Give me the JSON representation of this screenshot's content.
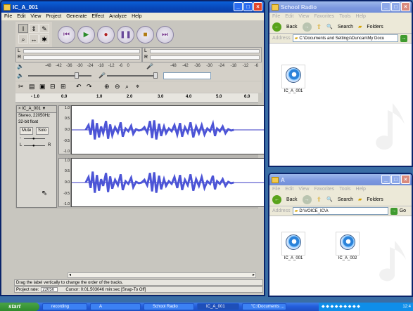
{
  "audacity": {
    "title": "IC_A_001",
    "menu": [
      "File",
      "Edit",
      "View",
      "Project",
      "Generate",
      "Effect",
      "Analyze",
      "Help"
    ],
    "meters": {
      "left": "L",
      "right": "R",
      "scale": [
        "-48",
        "-42",
        "-36",
        "-30",
        "-24",
        "-18",
        "-12",
        "-6",
        "0"
      ],
      "scale2": [
        "-48",
        "-42",
        "-36",
        "-30",
        "-24",
        "-18",
        "-12",
        "-6"
      ]
    },
    "ruler": [
      "- 1.0",
      "0.0",
      "1.0",
      "2.0",
      "3.0",
      "4.0",
      "5.0",
      "6.0"
    ],
    "track": {
      "name": "IC_A_001",
      "format": "Stereo, 22050Hz",
      "bits": "32-bit float",
      "mute": "Mute",
      "solo": "Solo",
      "l": "L",
      "r": "R",
      "scale_top": [
        "1.0",
        "0.5",
        "0.0",
        "-0.5",
        "-1.0"
      ],
      "scale_bottom": [
        "1.0",
        "0.5",
        "0.0",
        "-0.5",
        "-1.0"
      ]
    },
    "status_msg": "Drag the label vertically to change the order of the tracks.",
    "project_rate_label": "Project rate:",
    "project_rate": "22050",
    "cursor": "Cursor: 0:01.503046 min:sec  [Snap-To Off]"
  },
  "school_radio": {
    "title": "School Radio",
    "menu": [
      "File",
      "Edit",
      "View",
      "Favorites",
      "Tools",
      "Help"
    ],
    "back": "Back",
    "search": "Search",
    "folders": "Folders",
    "address_label": "Address",
    "address": "C:\\Documents and Settings\\Duncan\\My Docu",
    "go": "Go",
    "files": [
      "IC_A_001"
    ]
  },
  "explorer2": {
    "title": "A",
    "menu": [
      "File",
      "Edit",
      "View",
      "Favorites",
      "Tools",
      "Help"
    ],
    "back": "Back",
    "search": "Search",
    "folders": "Folders",
    "address_label": "Address",
    "address": "D:\\VOICE_IC\\A",
    "go": "Go",
    "files": [
      "IC_A_001",
      "IC_A_002"
    ]
  },
  "taskbar": {
    "start": "start",
    "tasks": [
      "recording",
      "A",
      "School Radio",
      "IC_A_001",
      "\"C:\\Documents ..."
    ],
    "clock": "12:4"
  }
}
